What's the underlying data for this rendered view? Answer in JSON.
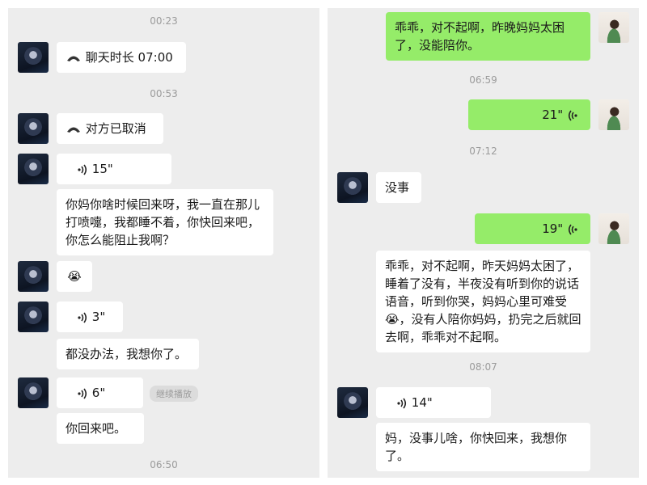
{
  "left": {
    "times": [
      "00:23",
      "00:53",
      "06:50"
    ],
    "call_duration": "聊天时长 07:00",
    "call_cancelled": "对方已取消",
    "voice": [
      "15\"",
      "3\"",
      "6\""
    ],
    "texts": [
      "你妈你啥时候回来呀，我一直在那儿打喷嚏，我都睡不着，你快回来吧，你怎么能阻止我啊？",
      "都没办法，我想你了。",
      "你回来吧。"
    ],
    "emoji": "😭",
    "continue_play": "继续播放"
  },
  "right": {
    "times": [
      "06:59",
      "07:12",
      "08:07"
    ],
    "msg1": "乖乖，对不起啊，昨晚妈妈太困了，没能陪你。",
    "voice": [
      "21\"",
      "19\"",
      "14\""
    ],
    "reply_ok": "没事",
    "long_msg": "乖乖，对不起啊，昨天妈妈太困了，睡着了没有，半夜没有听到你的说话语音，听到你哭，妈妈心里可难受😭，没有人陪你妈妈，扔完之后就回去啊，乖乖对不起啊。",
    "final_msg": "妈，没事儿啥，你快回来，我想你了。"
  },
  "colors": {
    "background": "#ededed",
    "bubble_self": "#95ec69",
    "bubble_other": "#ffffff",
    "timestamp": "#9b9b9b"
  }
}
